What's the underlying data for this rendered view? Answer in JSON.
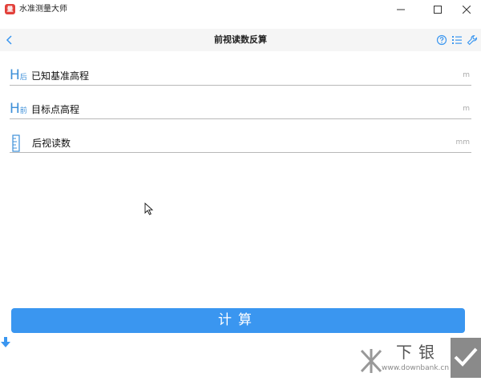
{
  "window": {
    "title": "水准测量大师",
    "app_icon_glyph": "量"
  },
  "header": {
    "title": "前视读数反算"
  },
  "fields": [
    {
      "prefix": "H",
      "prefix_sub": "后",
      "label": "已知基准高程",
      "unit": "m"
    },
    {
      "prefix": "H",
      "prefix_sub": "前",
      "label": "目标点高程",
      "unit": "m"
    },
    {
      "label": "后视读数",
      "unit": "mm"
    }
  ],
  "calc_button": {
    "label": "计算"
  },
  "watermark": {
    "text": "下银",
    "url": "www.downbank.cn"
  },
  "colors": {
    "accent": "#3a96f0",
    "prefix": "#3c8fd8",
    "app_icon": "#e2403a"
  }
}
